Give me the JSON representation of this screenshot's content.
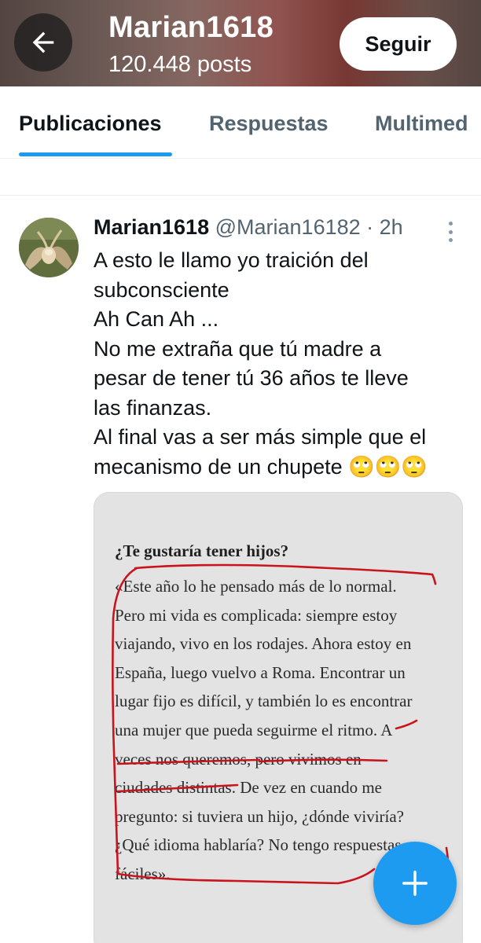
{
  "header": {
    "name": "Marian1618",
    "posts_count": "120.448 posts",
    "follow_label": "Seguir",
    "back_icon": "arrow-left-icon"
  },
  "tabs": {
    "items": [
      {
        "label": "Publicaciones",
        "active": true
      },
      {
        "label": "Respuestas",
        "active": false
      },
      {
        "label": "Multimed",
        "active": false
      }
    ],
    "accent_color": "#1d9bf0"
  },
  "post": {
    "author_name": "Marian1618",
    "meta": "@Marian16182 · 2h",
    "lines": [
      "A esto le llamo yo traición del",
      "subconsciente",
      "Ah Can Ah ...",
      "No me extraña que tú madre a",
      "pesar de tener tú 36 años te lleve",
      "las finanzas.",
      "Al final vas a ser más simple que el",
      "mecanismo de un chupete 🙄🙄🙄"
    ],
    "media": {
      "title": "¿Te gustaría tener hijos?",
      "lines": [
        "«Este año lo he pensado más de lo normal.",
        "Pero mi vida es complicada: siempre estoy",
        "viajando, vivo en los rodajes. Ahora estoy en",
        "España, luego vuelvo a Roma. Encontrar un",
        "lugar fijo es difícil, y también lo es encontrar",
        "una mujer que pueda seguirme el ritmo. A",
        "veces nos queremos, pero vivimos en",
        "ciudades distintas. De vez en cuando me",
        "pregunto: si tuviera un hijo, ¿dónde viviría?",
        "¿Qué idioma hablaría? No tengo respuestas",
        "fáciles»."
      ],
      "annotation_color": "#c8141c"
    }
  },
  "fab": {
    "icon": "plus-icon",
    "color": "#1d9bf0"
  }
}
